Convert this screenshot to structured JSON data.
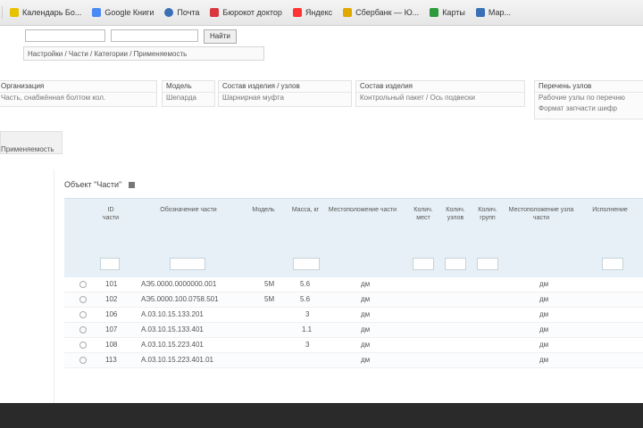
{
  "bookmarks": [
    {
      "label": "Календарь Бо...",
      "color": "#e6c200",
      "icon": "calendar-icon"
    },
    {
      "label": "Google Книги",
      "color": "#4a8af4",
      "icon": "google-books-icon"
    },
    {
      "label": "Почта",
      "color": "#3b6fb6",
      "icon": "mail-icon"
    },
    {
      "label": "Бюрокот доктор",
      "color": "#d9363e",
      "icon": "bookmark-icon"
    },
    {
      "label": "Яндекс",
      "color": "#ff3333",
      "icon": "yandex-icon"
    },
    {
      "label": "Сбербанк — Ю...",
      "color": "#e0a800",
      "icon": "bank-icon"
    },
    {
      "label": "Карты",
      "color": "#2e9a3e",
      "icon": "maps-icon"
    },
    {
      "label": "Мар...",
      "color": "#3b6fb6",
      "icon": "bookmark-icon"
    }
  ],
  "search": {
    "input1_value": "",
    "input2_value": "",
    "button_label": "Найти"
  },
  "breadcrumb": "Настройки / Части / Категории / Применяемость",
  "filters": [
    {
      "header": "Организация",
      "value": "Часть, снабжённая болтом кол."
    },
    {
      "header": "Модель",
      "value": "Шепарда"
    },
    {
      "header": "Состав изделия / узлов",
      "value": "Шарнирная муфта"
    },
    {
      "header": "Состав изделия",
      "value": "Контрольный пакет / Ось подвески"
    },
    {
      "header": "Перечень узлов",
      "value": "Рабочие узлы по перечню"
    },
    {
      "header": "",
      "value": "Формат запчасти шифр"
    }
  ],
  "side_tab_label": "Применяемость",
  "object_title": "Объект \"Части\"",
  "grid": {
    "headers": [
      "ID части",
      "Обозначение части",
      "Модель",
      "Масса, кг",
      "Местоположение части",
      "Колич. мест",
      "Колич. узлов",
      "Колич. групп",
      "Местоположение узла части",
      "Исполнение"
    ],
    "rows": [
      {
        "id": "101",
        "code": "АЭ5.0000.0000000.001",
        "model": "5М",
        "mass": "5.6",
        "place": "дм",
        "place2": "дм"
      },
      {
        "id": "102",
        "code": "АЭ5.0000.100.0758.501",
        "model": "5М",
        "mass": "5.6",
        "place": "дм",
        "place2": "дм"
      },
      {
        "id": "106",
        "code": "А.03.10.15.133.201",
        "model": "",
        "mass": "3",
        "place": "дм",
        "place2": "дм"
      },
      {
        "id": "107",
        "code": "А.03.10.15.133.401",
        "model": "",
        "mass": "1.1",
        "place": "дм",
        "place2": "дм"
      },
      {
        "id": "108",
        "code": "А.03.10.15.223.401",
        "model": "",
        "mass": "3",
        "place": "дм",
        "place2": "дм"
      },
      {
        "id": "113",
        "code": "А.03.10.15.223.401.01",
        "model": "",
        "mass": "",
        "place": "дм",
        "place2": "дм"
      }
    ]
  }
}
